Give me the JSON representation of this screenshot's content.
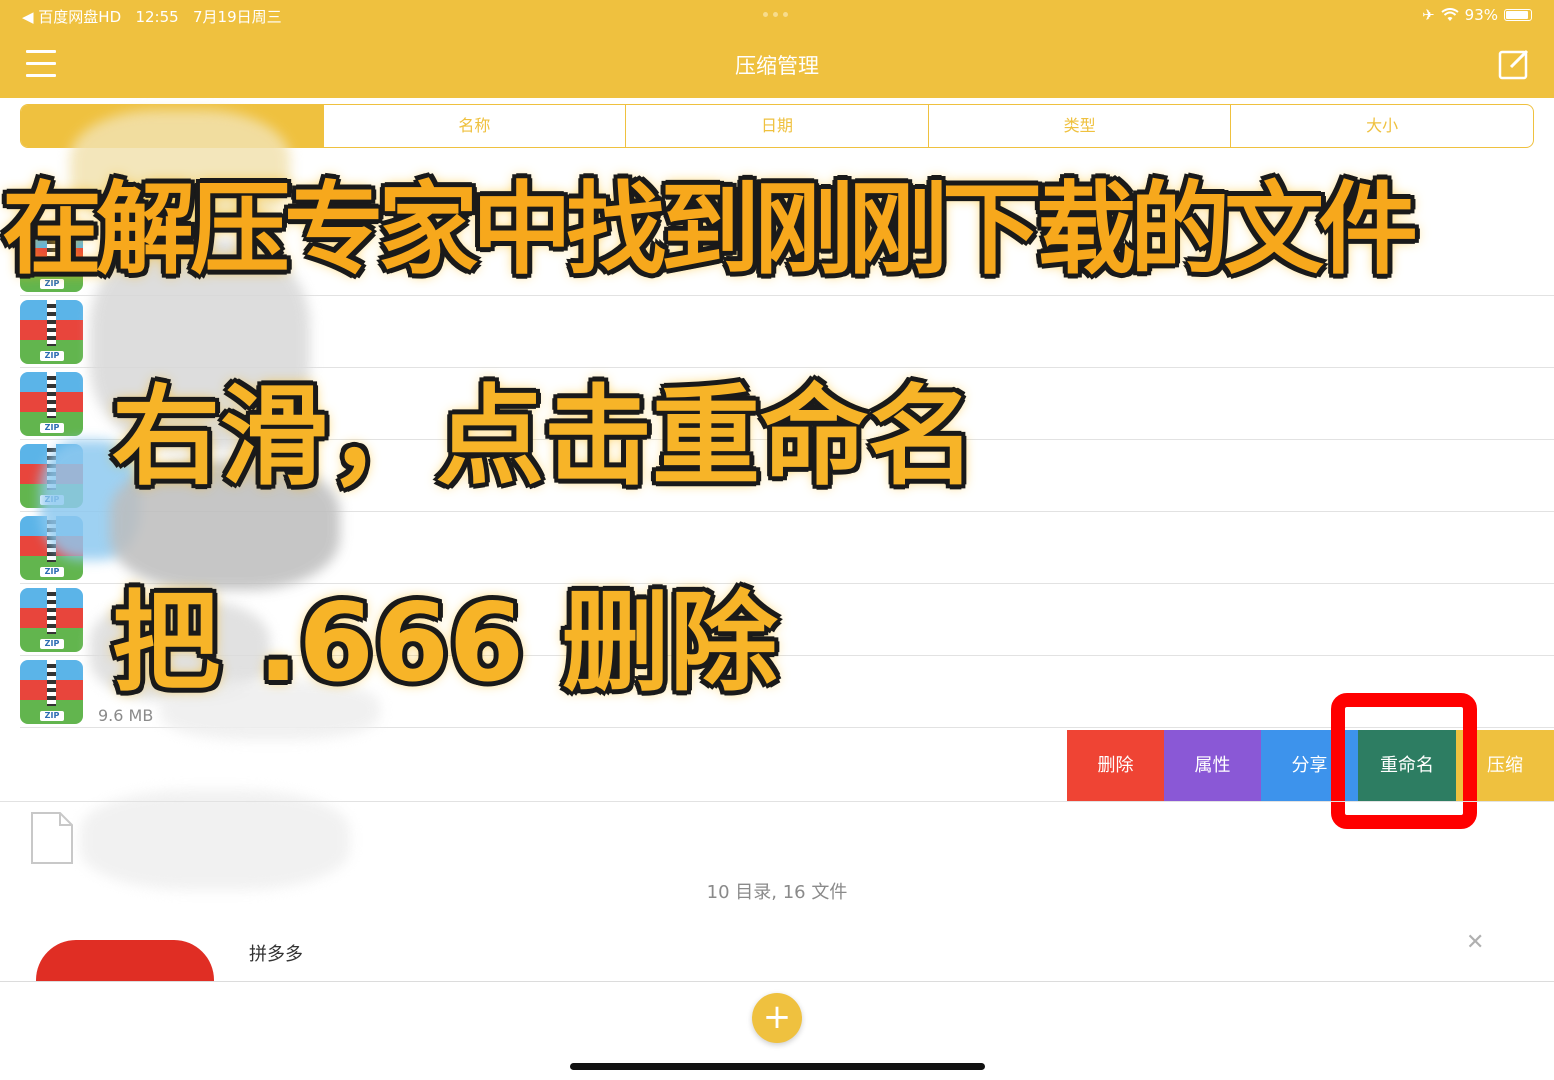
{
  "status_bar": {
    "back_app": "◀ 百度网盘HD",
    "time": "12:55",
    "date": "7月19日周三",
    "battery": "93%"
  },
  "nav": {
    "title": "压缩管理"
  },
  "sort_tabs": [
    "名称",
    "日期",
    "类型",
    "大小"
  ],
  "files": [
    {
      "size": "9.6 MB"
    }
  ],
  "actions": {
    "delete": "删除",
    "properties": "属性",
    "share": "分享",
    "rename": "重命名",
    "compress": "压缩"
  },
  "summary": "10 目录, 16 文件",
  "ad": {
    "name": "拼多多"
  },
  "captions": {
    "line1": "在解压专家中找到刚刚下载的文件",
    "line2": "右滑，点击重命名",
    "line3": "把 .666 删除"
  },
  "colors": {
    "accent": "#efc13f",
    "delete": "#ef4434",
    "properties": "#8a58d6",
    "share": "#3d93ec",
    "rename": "#2d7d62",
    "highlight": "#ff0000"
  }
}
